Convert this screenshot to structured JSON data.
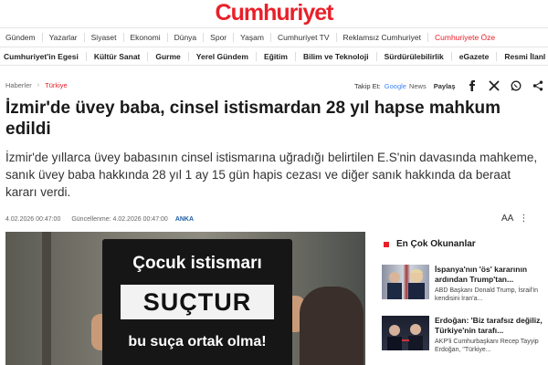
{
  "brand": {
    "logo_text": "Cumhuriyet",
    "accent_color": "#e8202a"
  },
  "nav_primary": [
    "Gündem",
    "Yazarlar",
    "Siyaset",
    "Ekonomi",
    "Dünya",
    "Spor",
    "Yaşam",
    "Cumhuriyet TV",
    "Reklamsız Cumhuriyet",
    "Cumhuriyete Öze"
  ],
  "nav_secondary": [
    "Cumhuriyet'in Egesi",
    "Kültür Sanat",
    "Gurme",
    "Yerel Gündem",
    "Eğitim",
    "Bilim ve Teknoloji",
    "Sürdürülebilirlik",
    "eGazete",
    "Resmi İlanl"
  ],
  "breadcrumb": {
    "home": "Haberler",
    "separator": "›",
    "category": "Türkiye"
  },
  "follow": {
    "label": "Takip Et:",
    "google": "Google",
    "news": "News",
    "share": "Paylaş",
    "social_icons": [
      "facebook-icon",
      "x-icon",
      "whatsapp-icon",
      "share-icon"
    ]
  },
  "article": {
    "title": "İzmir'de üvey baba, cinsel istismardan 28 yıl hapse mahkum edildi",
    "summary": "İzmir'de yıllarca üvey babasının cinsel istismarına uğradığı belirtilen E.S'nin davasında mahkeme, sanık üvey baba hakkında 28 yıl 1 ay 15 gün hapis cezası ve diğer sanık hakkında da beraat kararı verdi.",
    "published": "4.02.2026 00:47:00",
    "updated": "Güncellenme: 4.02.2026 00:47:00",
    "source": "ANKA",
    "tools": {
      "font_size": "AA",
      "more": "⋮"
    }
  },
  "photo": {
    "sign_line1": "Çocuk istismarı",
    "sign_line2": "SUÇTUR",
    "sign_line3": "bu suça ortak olma!"
  },
  "sidebar": {
    "title": "En Çok Okunanlar",
    "items": [
      {
        "headline": "İspanya'nın 'ös' kararının ardından Trump'tan...",
        "subtitle": "ABD Başkanı Donald Trump, İsrail'in kendisini İran'a..."
      },
      {
        "headline": "Erdoğan: 'Biz tarafsız değiliz, Türkiye'nin tarafı...",
        "subtitle": "AKP'li Cumhurbaşkanı Recep Tayyip Erdoğan, \"Türkiye..."
      }
    ]
  }
}
